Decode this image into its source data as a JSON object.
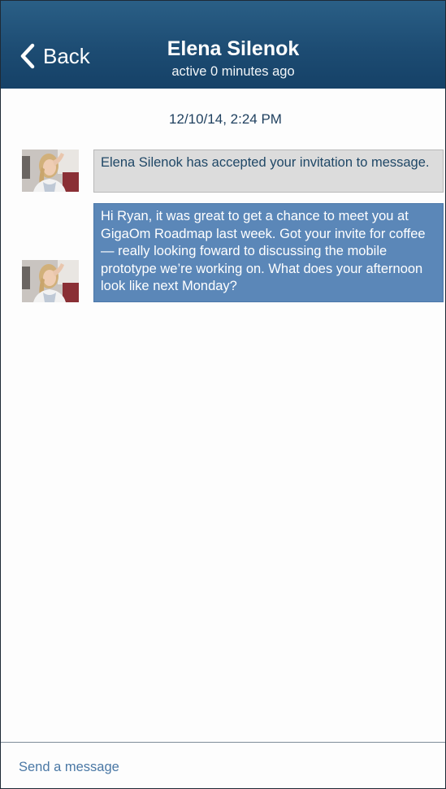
{
  "header": {
    "back_label": "Back",
    "contact_name": "Elena Silenok",
    "contact_status": "active 0 minutes ago"
  },
  "conversation": {
    "timestamp": "12/10/14, 2:24 PM",
    "messages": [
      {
        "type": "system",
        "text": "Elena Silenok has accepted your invitation to message."
      },
      {
        "type": "incoming",
        "text": "Hi Ryan, it was great to get a chance to meet you at GigaOm Roadmap last week. Got your invite for coffee — really looking foward to discussing the mobile prototype we’re working on. What does your afternoon look like next Monday?"
      }
    ]
  },
  "compose": {
    "placeholder": "Send a message",
    "value": ""
  },
  "colors": {
    "header_top": "#2a5f86",
    "header_bottom": "#154167",
    "system_bubble": "#dcdcdc",
    "message_bubble": "#5b87b8",
    "text_dark_blue": "#1f4766"
  },
  "icons": {
    "back": "chevron-left-icon"
  }
}
